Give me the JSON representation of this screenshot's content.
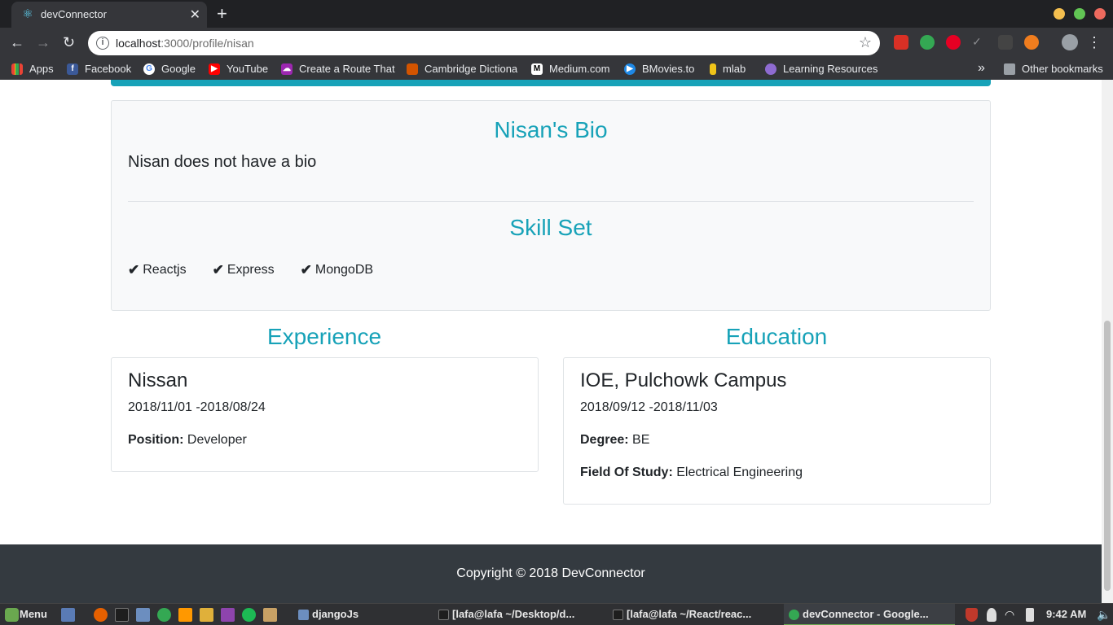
{
  "browser": {
    "tab_title": "devConnector",
    "tab_close": "✕",
    "new_tab": "+",
    "url_host": "localhost",
    "url_path": ":3000/profile/nisan",
    "bookmarks": [
      {
        "label": "Apps",
        "icon": "apps-grid-icon",
        "color": "#e8eaed"
      },
      {
        "label": "Facebook",
        "icon": "facebook-icon",
        "color": "#3b5998"
      },
      {
        "label": "Google",
        "icon": "google-icon",
        "color": "#ffffff"
      },
      {
        "label": "YouTube",
        "icon": "youtube-icon",
        "color": "#ff0000"
      },
      {
        "label": "Create a Route That",
        "icon": "cloud-icon",
        "color": "#9c27b0"
      },
      {
        "label": "Cambridge Dictiona",
        "icon": "cambridge-icon",
        "color": "#d35400"
      },
      {
        "label": "Medium.com",
        "icon": "medium-icon",
        "color": "#ffffff"
      },
      {
        "label": "BMovies.to",
        "icon": "play-icon",
        "color": "#1e88e5"
      },
      {
        "label": "mlab",
        "icon": "mlab-icon",
        "color": "#f0c419"
      },
      {
        "label": "Learning Resources",
        "icon": "learning-icon",
        "color": "#8e6bd1"
      }
    ],
    "overflow": "»",
    "other_bookmarks": "Other bookmarks"
  },
  "page": {
    "bio_title": "Nisan's Bio",
    "bio_text": "Nisan does not have a bio",
    "skill_title": "Skill Set",
    "skills": [
      "Reactjs",
      "Express",
      "MongoDB"
    ],
    "experience_title": "Experience",
    "education_title": "Education",
    "experience": {
      "company": "Nissan",
      "dates": "2018/11/01 -2018/08/24",
      "position_label": "Position:",
      "position": "Developer"
    },
    "education": {
      "school": "IOE, Pulchowk Campus",
      "dates": "2018/09/12 -2018/11/03",
      "degree_label": "Degree:",
      "degree": "BE",
      "field_label": "Field Of Study:",
      "field": "Electrical Engineering"
    },
    "footer": "Copyright © 2018 DevConnector",
    "accent_color": "#17a2b8"
  },
  "taskbar": {
    "menu_label": "Menu",
    "items": [
      "djangoJs",
      "[lafa@lafa ~/Desktop/d...",
      "[lafa@lafa ~/React/reac...",
      "devConnector - Google..."
    ],
    "clock": "9:42 AM"
  }
}
